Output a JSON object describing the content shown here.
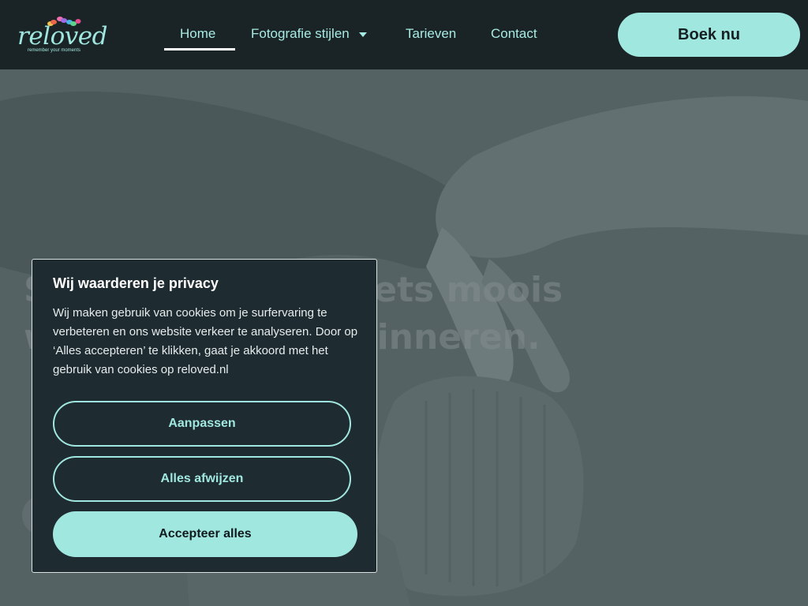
{
  "header": {
    "logo": {
      "word": "reloved",
      "tagline": "remember your moments"
    },
    "nav": {
      "home": "Home",
      "styles": "Fotografie stijlen",
      "prices": "Tarieven",
      "contact": "Contact"
    },
    "cta": "Boek nu"
  },
  "hero": {
    "line1": "Soms gebeurt er iets moois",
    "line2": "waar je je wilt herinneren."
  },
  "cookie": {
    "title": "Wij waarderen je privacy",
    "body": "Wij maken gebruik van cookies om je surfervaring te verbeteren en ons website verkeer te analyseren. Door op ‘Alles accepteren’ te klikken, gaat je akkoord met het gebruik van cookies op reloved.nl",
    "customize": "Aanpassen",
    "reject": "Alles afwijzen",
    "accept": "Accepteer alles"
  },
  "colors": {
    "header_bg": "#1a2326",
    "accent": "#a0e7df",
    "dialog_bg": "#1e2b31"
  },
  "icons": [
    "butterfly-icon",
    "caret-down-icon"
  ]
}
